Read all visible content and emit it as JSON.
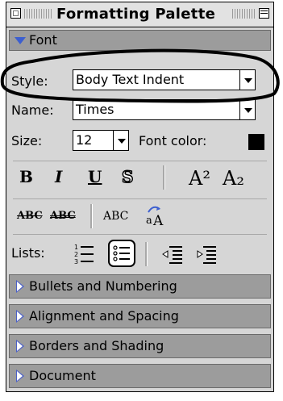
{
  "titlebar": {
    "title": "Formatting Palette"
  },
  "font_section": {
    "header": "Font",
    "style": {
      "label": "Style:",
      "value": "Body Text Indent"
    },
    "name": {
      "label": "Name:",
      "value": "Times"
    },
    "size": {
      "label": "Size:",
      "value": "12"
    },
    "font_color_label": "Font color:",
    "font_color": "#000000",
    "format_buttons": [
      "B",
      "I",
      "U",
      "S",
      "A²",
      "A₂"
    ],
    "strike_buttons": [
      "ABC",
      "ABC"
    ],
    "smallcaps_label": "ABC",
    "lists_label": "Lists:"
  },
  "collapsed_sections": [
    "Bullets and Numbering",
    "Alignment and Spacing",
    "Borders and Shading",
    "Document"
  ],
  "colors": {
    "section_header": "#9c9c9c",
    "triangle": "#4a5fc8",
    "panel": "#d6d6d6"
  }
}
